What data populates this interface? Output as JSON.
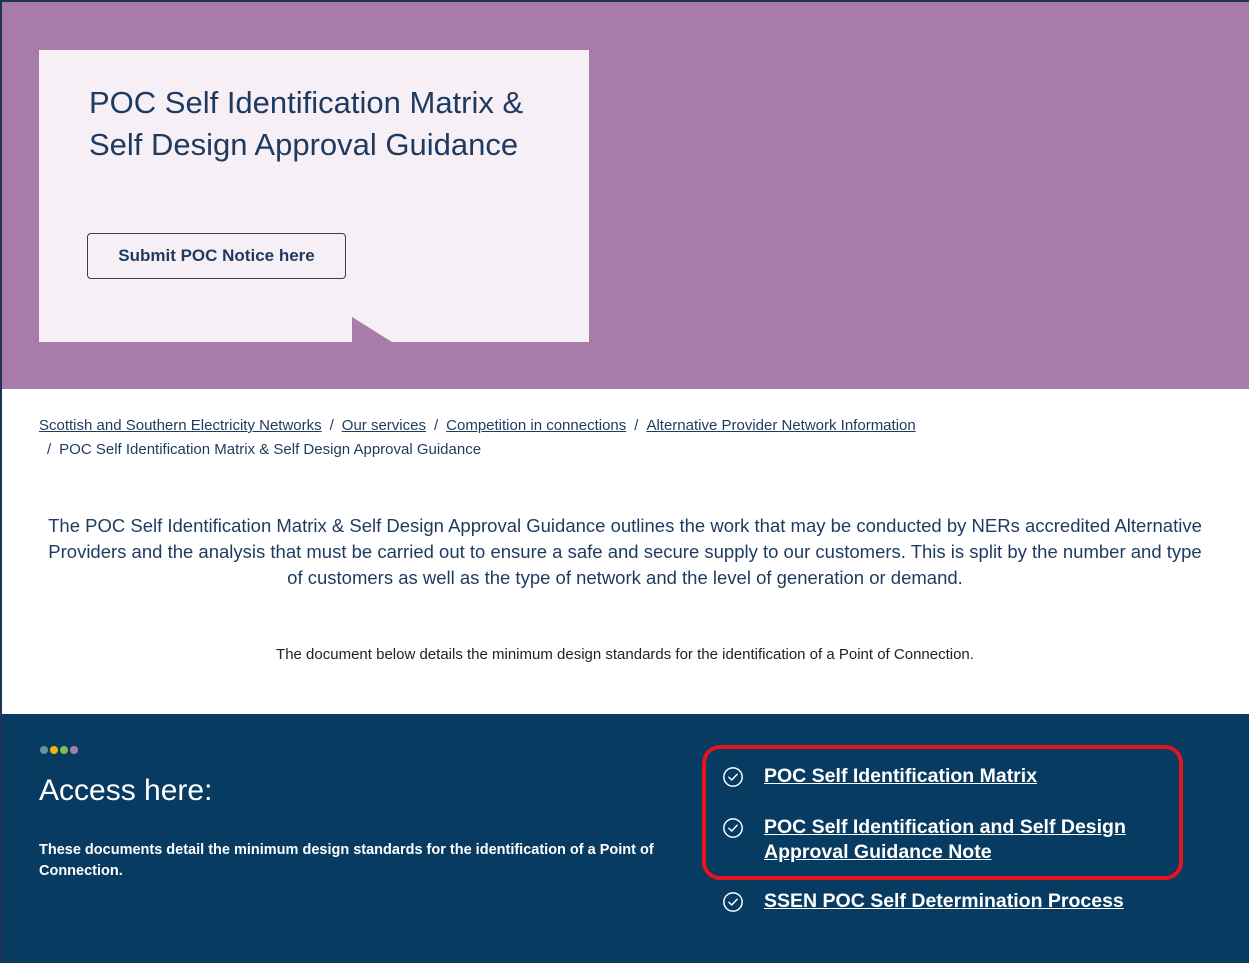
{
  "hero": {
    "title": "POC Self Identification Matrix & Self Design Approval Guidance",
    "button_label": "Submit POC Notice here"
  },
  "breadcrumb": {
    "items": [
      "Scottish and Southern Electricity Networks",
      "Our services",
      "Competition in connections",
      "Alternative Provider Network Information"
    ],
    "current": "POC Self Identification Matrix & Self Design Approval Guidance",
    "separator": "/"
  },
  "intro": {
    "paragraph": "The POC Self Identification Matrix & Self Design Approval Guidance outlines the work that may be conducted by NERs accredited Alternative Providers and the analysis that must be carried out to ensure a safe and secure supply to our customers. This is split by the number and type of customers as well as the type of network and the level of generation or demand.",
    "note": "The document below details the minimum design standards for the identification of a Point of Connection."
  },
  "access": {
    "title": "Access here:",
    "description": "These documents detail the minimum design standards for the identification of a Point of Connection.",
    "dot_colors": [
      "#6b8fa3",
      "#f2b705",
      "#7cbf4f",
      "#a87ba8"
    ],
    "links": [
      {
        "label": "POC Self Identification Matrix",
        "icon": "check-circle-icon"
      },
      {
        "label": "POC Self Identification and Self Design Approval Guidance Note",
        "icon": "check-circle-icon"
      },
      {
        "label": "SSEN POC Self Determination Process",
        "icon": "check-circle-icon"
      }
    ]
  },
  "colors": {
    "hero_bg": "#a87ba8",
    "card_bg": "#f6eff6",
    "access_bg": "#073b61",
    "highlight": "#e3151f",
    "text": "#1f3a5f"
  }
}
